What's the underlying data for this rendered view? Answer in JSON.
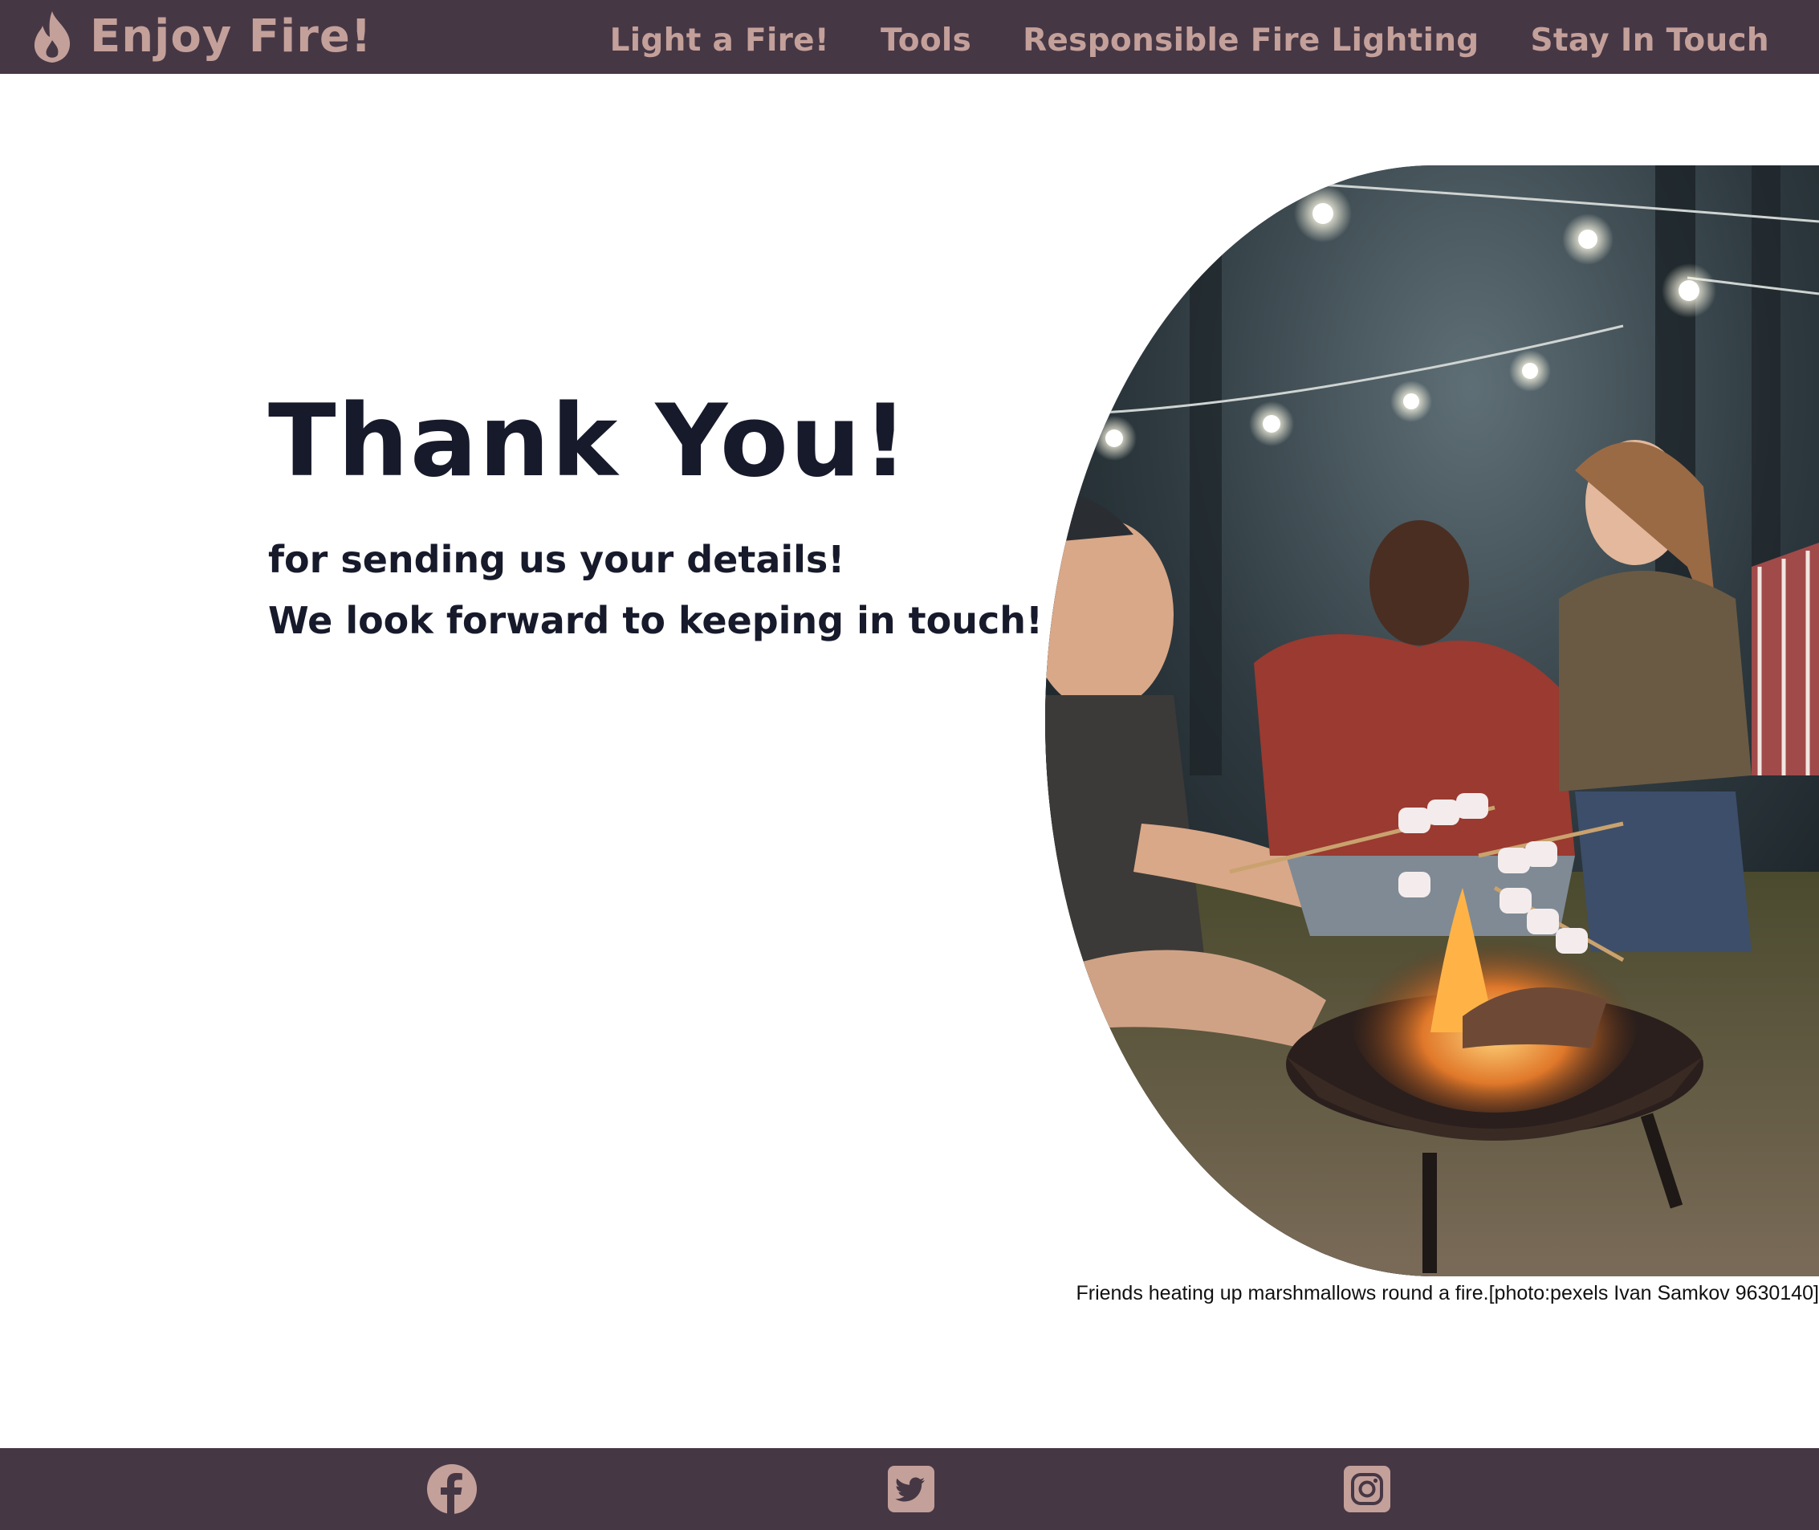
{
  "header": {
    "brand": "Enjoy Fire!",
    "brand_icon": "flame-icon",
    "nav": [
      {
        "label": "Light a Fire!"
      },
      {
        "label": "Tools"
      },
      {
        "label": "Responsible Fire Lighting"
      },
      {
        "label": "Stay In Touch"
      }
    ]
  },
  "main": {
    "title": "Thank You!",
    "line1": "for sending us your details!",
    "line2": "We look forward to keeping in touch!",
    "photo": {
      "caption": "Friends heating up marshmallows round a fire.[photo:pexels Ivan Samkov 9630140]"
    }
  },
  "footer": {
    "social": [
      {
        "icon": "facebook-icon"
      },
      {
        "icon": "twitter-icon"
      },
      {
        "icon": "instagram-icon"
      }
    ]
  },
  "colors": {
    "header_bg": "#463745",
    "accent": "#c4a09a",
    "text_dark": "#171a2b",
    "page_bg": "#ffffff"
  }
}
